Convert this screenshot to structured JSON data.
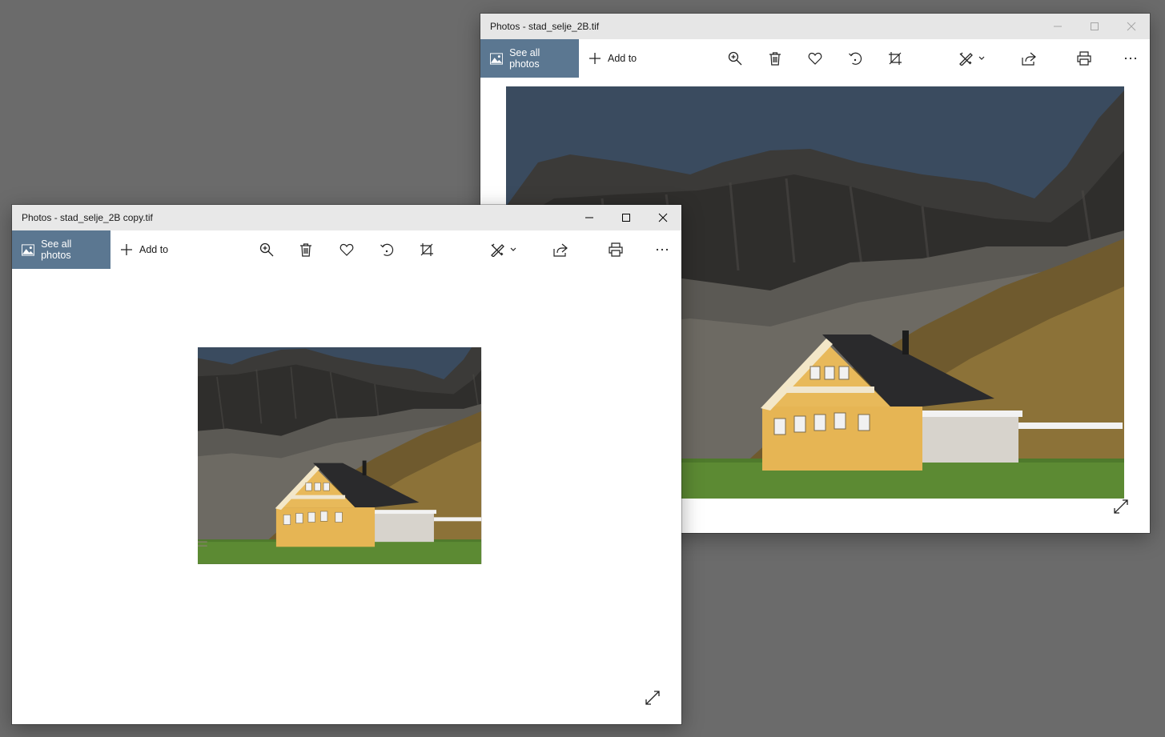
{
  "back_window": {
    "title": "Photos - stad_selje_2B.tif",
    "see_all_label": "See all photos",
    "add_to_label": "Add to"
  },
  "front_window": {
    "title": "Photos - stad_selje_2B copy.tif",
    "see_all_label": "See all photos",
    "add_to_label": "Add to"
  },
  "toolbar_icons": [
    "zoom-in-icon",
    "delete-icon",
    "heart-icon",
    "rotate-icon",
    "crop-icon",
    "edit-create-icon",
    "share-icon",
    "print-icon",
    "more-icon"
  ],
  "colors": {
    "accent": "#5b7791",
    "desktop": "#6b6b6b",
    "titlebar": "#e6e6e6"
  }
}
